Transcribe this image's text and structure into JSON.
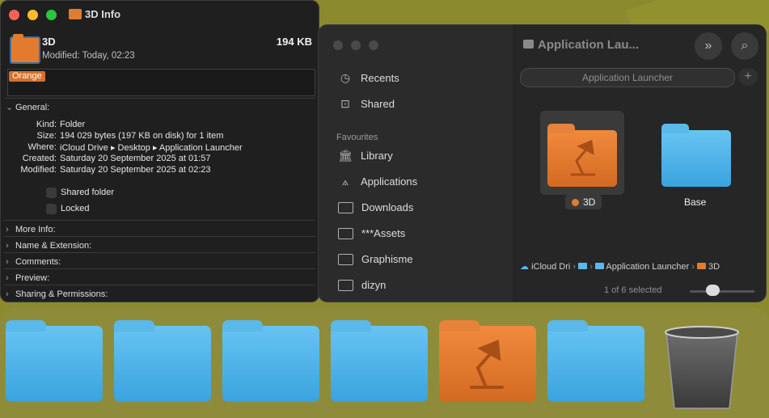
{
  "info_window": {
    "title": "3D Info",
    "file_name": "3D",
    "file_size": "194 KB",
    "modified_line": "Modified: Today, 02:23",
    "tag": "Orange",
    "general": {
      "header": "General:",
      "rows": [
        {
          "label": "Kind:",
          "value": "Folder"
        },
        {
          "label": "Size:",
          "value": "194 029 bytes (197 KB on disk) for 1 item"
        },
        {
          "label": "Where:",
          "value": "iCloud Drive ▸ Desktop ▸ Application Launcher"
        },
        {
          "label": "Created:",
          "value": "Saturday 20 September 2025 at 01:57"
        },
        {
          "label": "Modified:",
          "value": "Saturday 20 September 2025 at 02:23"
        }
      ],
      "shared_folder": "Shared folder",
      "locked": "Locked"
    },
    "sections": [
      "More Info:",
      "Name & Extension:",
      "Comments:",
      "Preview:",
      "Sharing & Permissions:"
    ]
  },
  "finder": {
    "title": "Application Lau...",
    "sidebar": {
      "items_top": [
        "Recents",
        "Shared"
      ],
      "favourites_header": "Favourites",
      "favourites": [
        "Library",
        "Applications",
        "Downloads",
        "***Assets",
        "Graphisme",
        "dizyn"
      ]
    },
    "path_field": "Application Launcher",
    "items": [
      "3D",
      "Base"
    ],
    "pathbar": [
      "iCloud Dri",
      "Application Launcher",
      "3D"
    ],
    "status": "1 of 6 selected",
    "zoom": 0.35
  },
  "colors": {
    "orange": "#e37b2f",
    "blue": "#5bb8ea"
  }
}
